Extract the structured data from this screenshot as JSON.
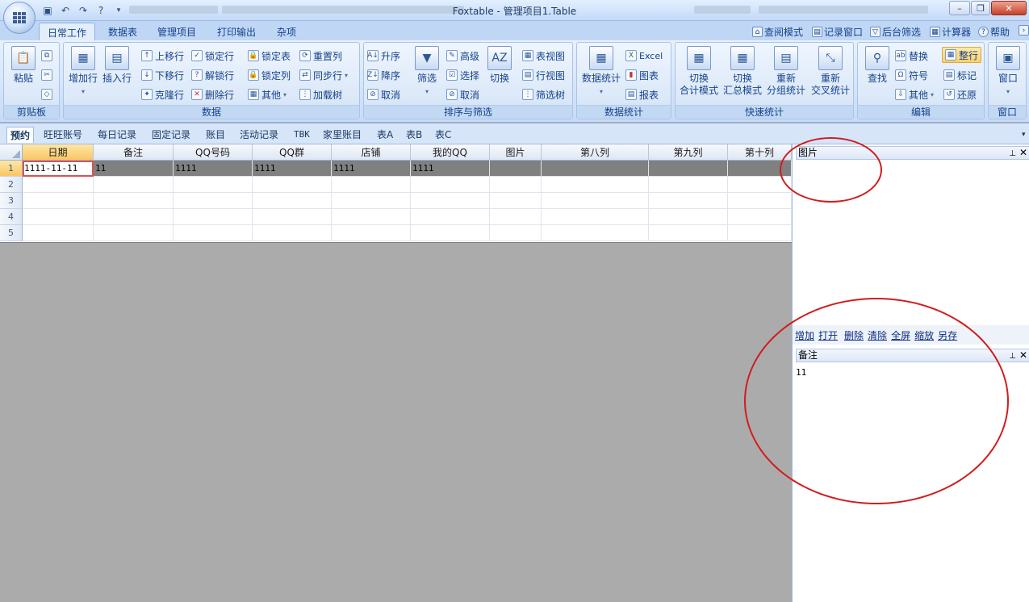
{
  "window": {
    "title": "Foxtable - 管理项目1.Table"
  },
  "ribbon_tabs": [
    "日常工作",
    "数据表",
    "管理项目",
    "打印输出",
    "杂项"
  ],
  "ribbon_tabs_right": [
    "查阅模式",
    "记录窗口",
    "后台筛选",
    "计算器",
    "帮助"
  ],
  "groups": {
    "clipboard": {
      "label": "剪贴板",
      "paste": "粘贴"
    },
    "data": {
      "label": "数据",
      "add_row": "增加行",
      "insert_row": "插入行",
      "move_up": "上移行",
      "move_down": "下移行",
      "clone_row": "克隆行",
      "lock_row": "锁定行",
      "unlock_row": "解锁行",
      "delete_row": "删除行",
      "lock_table": "锁定表",
      "lock_col": "锁定列",
      "other": "其他",
      "reset_col": "重置列",
      "sync_row": "同步行",
      "load_tree": "加载树"
    },
    "sort_filter": {
      "label": "排序与筛选",
      "asc": "升序",
      "desc": "降序",
      "cancel_sort": "取消",
      "filter": "筛选",
      "advanced": "高级",
      "select": "选择",
      "cancel_filter": "取消",
      "toggle": "切换",
      "table_view": "表视图",
      "row_view": "行视图",
      "filter_tree": "筛选树"
    },
    "stats": {
      "label": "数据统计",
      "data_stats": "数据统计",
      "excel": "Excel",
      "chart": "图表",
      "report": "报表"
    },
    "quick_stats": {
      "label": "快速统计",
      "b1_l1": "切换",
      "b1_l2": "合计模式",
      "b2_l1": "切换",
      "b2_l2": "汇总模式",
      "b3_l1": "重新",
      "b3_l2": "分组统计",
      "b4_l1": "重新",
      "b4_l2": "交叉统计"
    },
    "edit": {
      "label": "编辑",
      "find": "查找",
      "replace": "替换",
      "symbol": "符号",
      "other": "其他",
      "tidy_row": "整行",
      "mark": "标记",
      "restore": "还原"
    },
    "window": {
      "label": "窗口",
      "window": "窗口"
    }
  },
  "sheet_tabs": [
    "预约",
    "旺旺账号",
    "每日记录",
    "固定记录",
    "账目",
    "活动记录",
    "TBK",
    "家里账目",
    "表A",
    "表B",
    "表C"
  ],
  "table": {
    "columns": [
      "日期",
      "备注",
      "QQ号码",
      "QQ群",
      "店铺",
      "我的QQ",
      "图片",
      "第八列",
      "第九列",
      "第十列"
    ],
    "row_numbers": [
      "1",
      "2",
      "3",
      "4",
      "5"
    ],
    "rows": [
      [
        "1111-11-11",
        "11",
        "1111",
        "1111",
        "1111",
        "1111",
        "",
        "",
        "",
        ""
      ]
    ]
  },
  "panels": {
    "image_panel_title": "图片",
    "actions": [
      "增加",
      "打开",
      "删除",
      "清除",
      "全屏",
      "缩放",
      "另存"
    ],
    "note_panel_title": "备注",
    "note_text": "11"
  }
}
